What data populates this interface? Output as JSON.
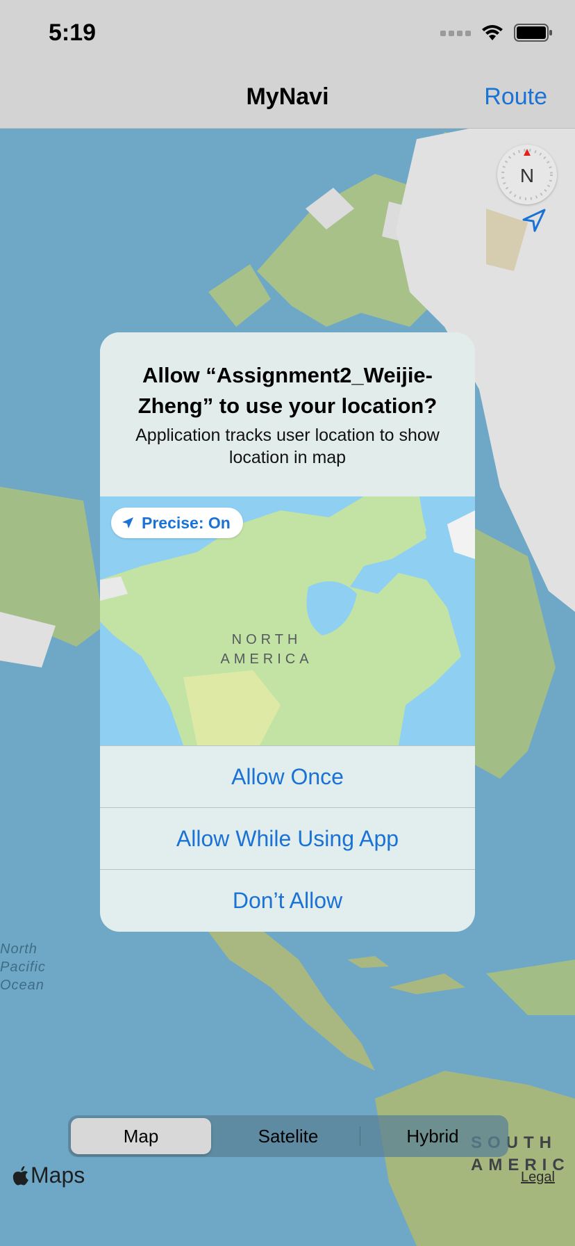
{
  "status_bar": {
    "time": "5:19"
  },
  "nav": {
    "title": "MyNavi",
    "route_label": "Route"
  },
  "compass": {
    "letter": "N"
  },
  "map": {
    "ocean_label": "North\nPacific\nOcean",
    "continent_label": "SOUTH\nAMERIC",
    "maps_brand": "Maps",
    "legal": "Legal"
  },
  "segmented": {
    "items": [
      "Map",
      "Satelite",
      "Hybrid"
    ],
    "selected": "Map"
  },
  "alert": {
    "title": "Allow “Assignment2_Weijie-Zheng” to use your location?",
    "message": "Application tracks user location to show location in map",
    "precise_label": "Precise: On",
    "map_label": "NORTH\nAMERICA",
    "buttons": {
      "allow_once": "Allow Once",
      "allow_while_using": "Allow While Using App",
      "dont_allow": "Don’t Allow"
    }
  },
  "colors": {
    "accent": "#1a73d4",
    "bar_bg": "#d3d3d3",
    "ocean": "#6fa8c6",
    "land": "#a9c48b"
  }
}
